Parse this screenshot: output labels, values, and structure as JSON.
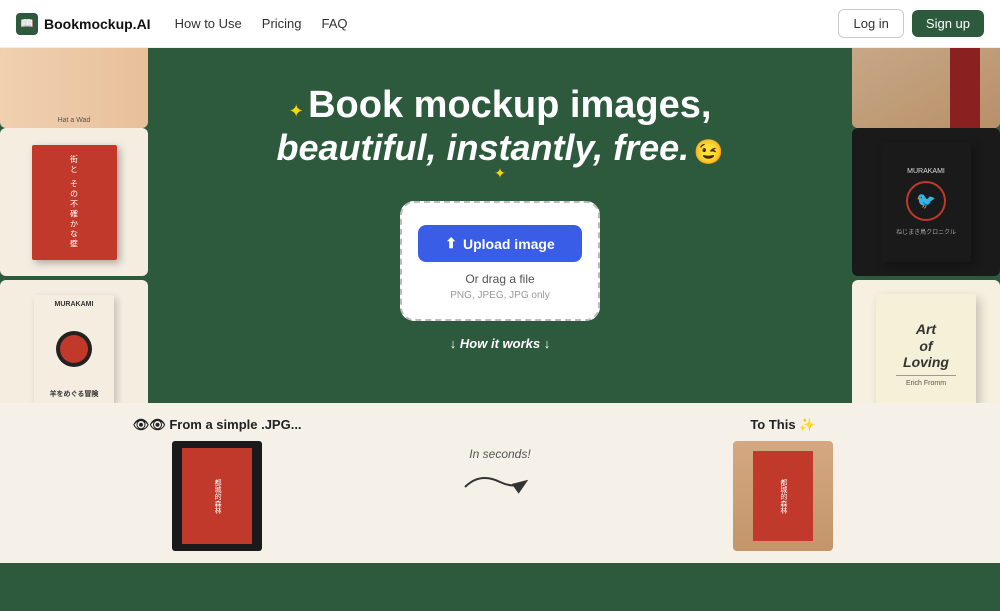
{
  "navbar": {
    "logo_icon": "📖",
    "logo_text": "Bookmockup.AI",
    "nav_links": [
      {
        "label": "How to Use",
        "id": "how-to-use"
      },
      {
        "label": "Pricing",
        "id": "pricing"
      },
      {
        "label": "FAQ",
        "id": "faq"
      }
    ],
    "login_label": "Log in",
    "signup_label": "Sign up"
  },
  "hero": {
    "title_line1": "Book mockup images,",
    "title_line2_italic": "beautiful, instantly, free.",
    "emoji": "😉",
    "star_label1": "✦",
    "star_label2": "✦",
    "sparkle": "✦"
  },
  "upload_box": {
    "button_label": "Upload image",
    "upload_icon": "⬆",
    "drag_text": "Or drag a file",
    "formats_text": "PNG, JPEG, JPG only"
  },
  "how_it_works": {
    "label": "↓ How it works ↓"
  },
  "bottom": {
    "from_label": "👁👁 From a simple .JPG...",
    "in_seconds": "In seconds!",
    "to_label": "To This ✨"
  }
}
